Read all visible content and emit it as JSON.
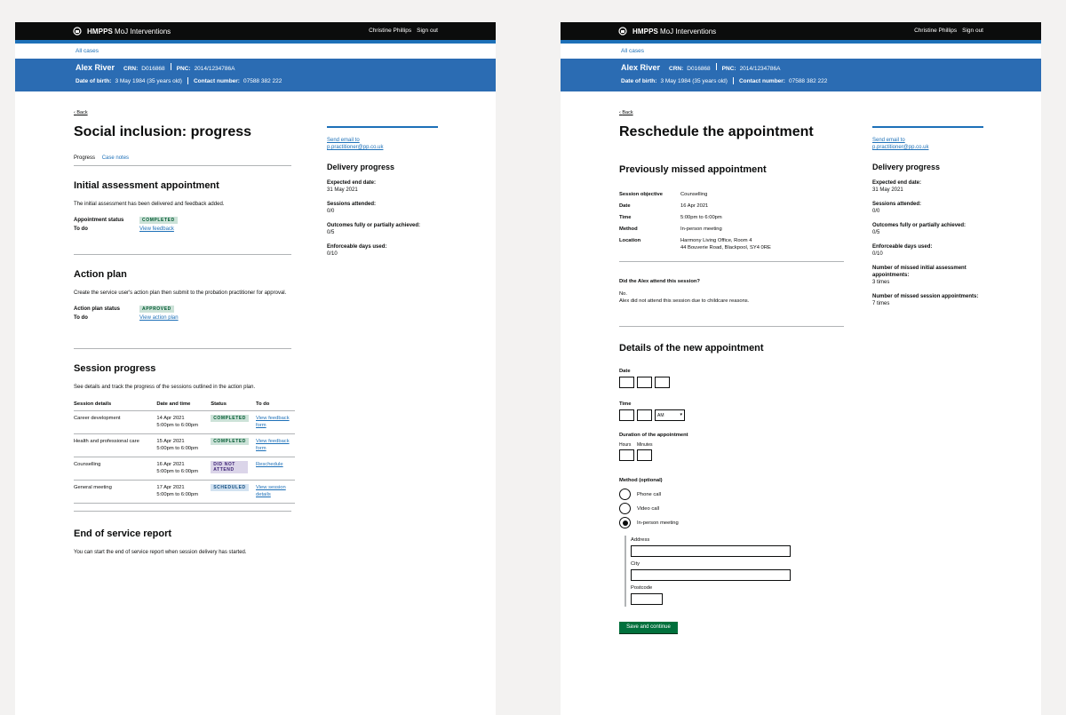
{
  "header": {
    "brand": "HMPPS",
    "service": "MoJ Interventions",
    "user": "Christine Phillips",
    "signout": "Sign out"
  },
  "nav": {
    "all_cases": "All cases"
  },
  "person": {
    "name": "Alex River",
    "crn_label": "CRN:",
    "crn": "D016868",
    "pnc_label": "PNC:",
    "pnc": "2014/1234786A",
    "dob_label": "Date of birth:",
    "dob": "3 May 1984 (35 years old)",
    "contact_label": "Contact number:",
    "contact": "07588 382 222"
  },
  "back": "Back",
  "left": {
    "title": "Social inclusion: progress",
    "tabs": [
      "Progress",
      "Case notes"
    ],
    "initial": {
      "heading": "Initial assessment appointment",
      "text": "The initial assessment has been delivered and feedback added.",
      "status_label": "Appointment status",
      "status": "COMPLETED",
      "todo_label": "To do",
      "todo": "View feedback"
    },
    "action": {
      "heading": "Action plan",
      "text": "Create the service user's action plan then submit to the probation practitioner for approval.",
      "status_label": "Action plan status",
      "status": "APPROVED",
      "todo_label": "To do",
      "todo": "View action plan"
    },
    "sessions": {
      "heading": "Session progress",
      "text": "See details and track the progress of the sessions outlined in the action plan.",
      "columns": [
        "Session details",
        "Date and time",
        "Status",
        "To do"
      ],
      "rows": [
        {
          "details": "Career development",
          "date": "14 Apr 2021",
          "time": "5:00pm to 6:00pm",
          "status": "COMPLETED",
          "todo": "View feedback form"
        },
        {
          "details": "Health and professional care",
          "date": "15 Apr 2021",
          "time": "5:00pm to 6:00pm",
          "status": "COMPLETED",
          "todo": "View feedback form"
        },
        {
          "details": "Counselling",
          "date": "16 Apr 2021",
          "time": "5:00pm to 6:00pm",
          "status": "DID NOT ATTEND",
          "todo": "Reschedule"
        },
        {
          "details": "General meeting",
          "date": "17 Apr 2021",
          "time": "5:00pm to 6:00pm",
          "status": "SCHEDULED",
          "todo": "View session details"
        }
      ]
    },
    "end": {
      "heading": "End of service report",
      "text": "You can start the end of service report when session delivery has started."
    }
  },
  "sidebar_left": {
    "email": "Send email to p.practitioner@pp.co.uk",
    "heading": "Delivery progress",
    "items": [
      {
        "label": "Expected end date:",
        "value": "31 May 2021"
      },
      {
        "label": "Sessions attended:",
        "value": "0/0"
      },
      {
        "label": "Outcomes fully or partially achieved:",
        "value": "0/5"
      },
      {
        "label": "Enforceable days used:",
        "value": "0/10"
      }
    ]
  },
  "sidebar_right": {
    "email": "Send email to p.practitioner@pp.co.uk",
    "heading": "Delivery progress",
    "items": [
      {
        "label": "Expected end date:",
        "value": "31 May 2021"
      },
      {
        "label": "Sessions attended:",
        "value": "0/0"
      },
      {
        "label": "Outcomes fully or partially achieved:",
        "value": "0/5"
      },
      {
        "label": "Enforceable days used:",
        "value": "0/10"
      },
      {
        "label": "Number of missed initial assessment appointments:",
        "value": "3 times"
      },
      {
        "label": "Number of missed session appointments:",
        "value": "7 times"
      }
    ]
  },
  "right": {
    "title": "Reschedule the appointment",
    "missed_heading": "Previously missed appointment",
    "details": [
      {
        "label": "Session objective",
        "value": "Counselling"
      },
      {
        "label": "Date",
        "value": "16 Apr 2021"
      },
      {
        "label": "Time",
        "value": "5:00pm to 6:00pm"
      },
      {
        "label": "Method",
        "value": "In-person meeting"
      },
      {
        "label": "Location",
        "value": "Harmony Living Office, Room 4",
        "value2": "44  Bouverie Road, Blackpool, SY4 0RE"
      }
    ],
    "attend_q": "Did the Alex attend this session?",
    "attend_a": "No.",
    "attend_reason": "Alex did not attend this session due to childcare reasons.",
    "new_heading": "Details of the new appointment",
    "date_label": "Date",
    "time_label": "Time",
    "ampm": "AM",
    "duration_label": "Duration of the appointment",
    "hours": "Hours",
    "minutes": "Minutes",
    "method_label": "Method (optional)",
    "methods": [
      "Phone call",
      "Video call",
      "In-person meeting"
    ],
    "address_label": "Address",
    "city_label": "City",
    "postcode_label": "Postcode",
    "save": "Save and continue"
  }
}
